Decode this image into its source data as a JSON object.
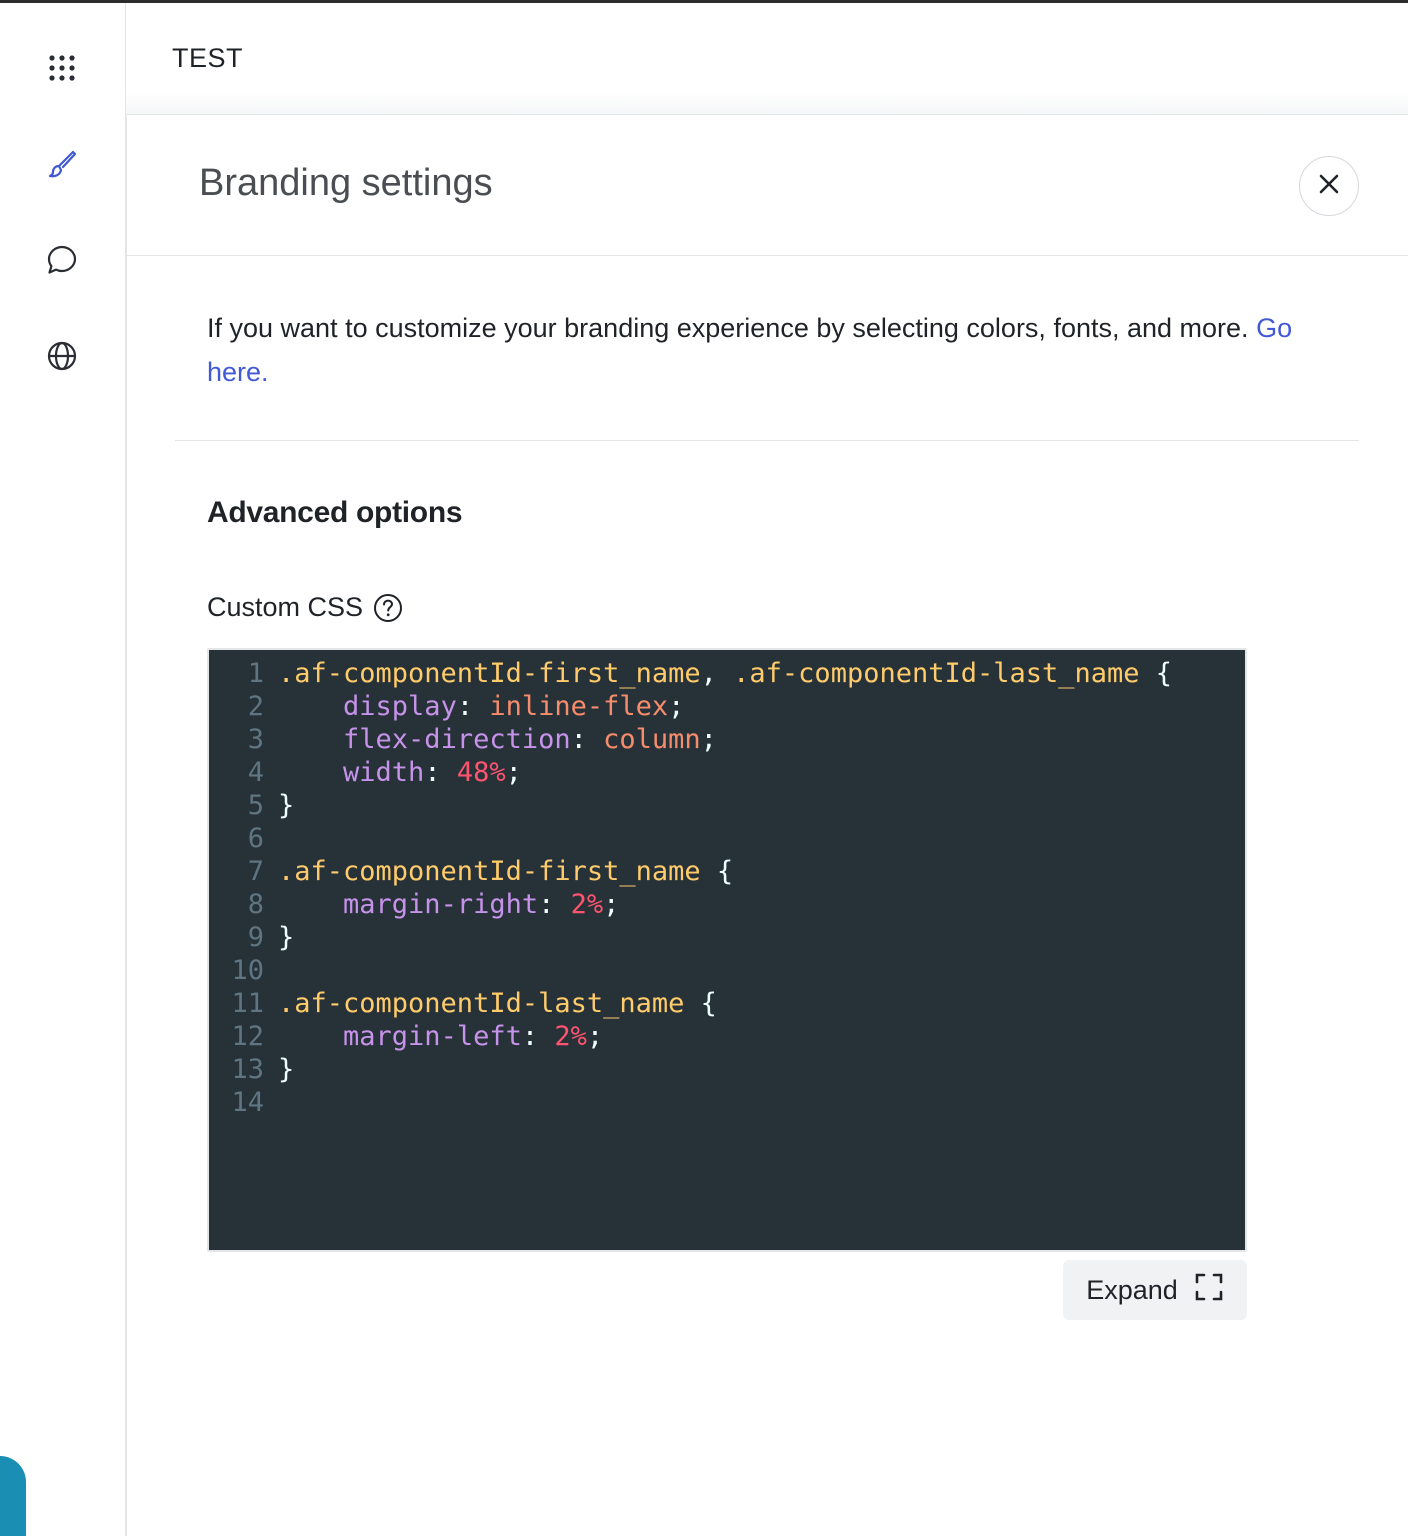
{
  "topbar": {
    "title": "TEST"
  },
  "rail": {
    "items": [
      {
        "icon": "apps-grid-icon",
        "active": false
      },
      {
        "icon": "paintbrush-icon",
        "active": true
      },
      {
        "icon": "chat-bubble-icon",
        "active": false
      },
      {
        "icon": "globe-icon",
        "active": false
      }
    ]
  },
  "panel": {
    "title": "Branding settings",
    "intro_text": "If you want to customize your branding experience by selecting colors, fonts, and more.",
    "intro_link": "Go here.",
    "section_title": "Advanced options",
    "css_label": "Custom CSS",
    "expand_label": "Expand"
  },
  "editor": {
    "line_numbers": [
      "1",
      "2",
      "3",
      "4",
      "5",
      "6",
      "7",
      "8",
      "9",
      "10",
      "11",
      "12",
      "13",
      "14"
    ],
    "lines": [
      [
        {
          "t": "sel",
          "v": ".af-componentId-first_name"
        },
        {
          "t": "punc",
          "v": ", "
        },
        {
          "t": "sel",
          "v": ".af-componentId-last_name"
        },
        {
          "t": "punc",
          "v": " {"
        }
      ],
      [
        {
          "t": "punc",
          "v": "    "
        },
        {
          "t": "prop",
          "v": "display"
        },
        {
          "t": "punc",
          "v": ": "
        },
        {
          "t": "val",
          "v": "inline-flex"
        },
        {
          "t": "punc",
          "v": ";"
        }
      ],
      [
        {
          "t": "punc",
          "v": "    "
        },
        {
          "t": "prop",
          "v": "flex-direction"
        },
        {
          "t": "punc",
          "v": ": "
        },
        {
          "t": "val",
          "v": "column"
        },
        {
          "t": "punc",
          "v": ";"
        }
      ],
      [
        {
          "t": "punc",
          "v": "    "
        },
        {
          "t": "prop",
          "v": "width"
        },
        {
          "t": "punc",
          "v": ": "
        },
        {
          "t": "num",
          "v": "48%"
        },
        {
          "t": "punc",
          "v": ";"
        }
      ],
      [
        {
          "t": "punc",
          "v": "}"
        }
      ],
      [],
      [
        {
          "t": "sel",
          "v": ".af-componentId-first_name"
        },
        {
          "t": "punc",
          "v": " {"
        }
      ],
      [
        {
          "t": "punc",
          "v": "    "
        },
        {
          "t": "prop",
          "v": "margin-right"
        },
        {
          "t": "punc",
          "v": ": "
        },
        {
          "t": "num",
          "v": "2%"
        },
        {
          "t": "punc",
          "v": ";"
        }
      ],
      [
        {
          "t": "punc",
          "v": "}"
        }
      ],
      [],
      [
        {
          "t": "sel",
          "v": ".af-componentId-last_name"
        },
        {
          "t": "punc",
          "v": " {"
        }
      ],
      [
        {
          "t": "punc",
          "v": "    "
        },
        {
          "t": "prop",
          "v": "margin-left"
        },
        {
          "t": "punc",
          "v": ": "
        },
        {
          "t": "num",
          "v": "2%"
        },
        {
          "t": "punc",
          "v": ";"
        }
      ],
      [
        {
          "t": "punc",
          "v": "}"
        }
      ],
      []
    ]
  },
  "colors": {
    "accent": "#4259d6",
    "editor_bg": "#263238",
    "selector": "#ffcb6b",
    "property": "#c792ea",
    "value": "#f78c6c",
    "number": "#ff5370"
  }
}
